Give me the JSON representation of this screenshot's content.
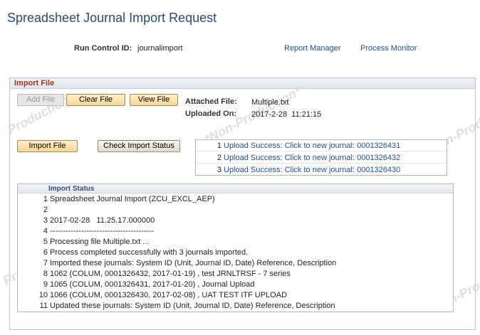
{
  "page": {
    "title": "Spreadsheet Journal Import Request"
  },
  "run_control": {
    "label": "Run Control ID:",
    "value": "journalimport"
  },
  "header_links": {
    "report_manager": "Report Manager",
    "process_monitor": "Process Monitor"
  },
  "watermark": {
    "text_a": "*Non-Production*",
    "text_b": "Production*",
    "text_c": "*Non-Production*"
  },
  "import_file": {
    "title": "Import File",
    "buttons": {
      "add_file": "Add File",
      "clear_file": "Clear File",
      "view_file": "View File",
      "import_file": "Import File",
      "check_status": "Check Import Status"
    },
    "attached_label": "Attached File:",
    "attached_value": "Multiple.txt",
    "uploaded_label": "Uploaded On:",
    "uploaded_value": "2017-2-28  11:21:15"
  },
  "upload_results": [
    {
      "num": "1",
      "text": "Upload Success: Click to new journal: 0001326431"
    },
    {
      "num": "2",
      "text": "Upload Success: Click to new journal: 0001326432"
    },
    {
      "num": "3",
      "text": "Upload Success: Click to new journal: 0001326430"
    }
  ],
  "import_status": {
    "title": "Import Status",
    "lines": [
      {
        "num": "1",
        "text": "Spreadsheet Journal Import (ZCU_EXCL_AEP)"
      },
      {
        "num": "2",
        "text": ""
      },
      {
        "num": "3",
        "text": "2017-02-28   11.25.17.000000"
      },
      {
        "num": "4",
        "text": "----------------------------------------"
      },
      {
        "num": "5",
        "text": "Processing file Multiple.txt ..."
      },
      {
        "num": "6",
        "text": "Process completed successfully with 3 journals imported."
      },
      {
        "num": "7",
        "text": "Imported these journals: System ID (Unit, Journal ID, Date) Reference, Description"
      },
      {
        "num": "8",
        "text": "1062 (COLUM, 0001326432, 2017-01-19) , test JRNLTRSF - 7 series"
      },
      {
        "num": "9",
        "text": "1065 (COLUM, 0001326431, 2017-01-20) , Journal Upload"
      },
      {
        "num": "10",
        "text": "1066 (COLUM, 0001326430, 2017-02-08) , UAT TEST ITF UPLOAD"
      },
      {
        "num": "11",
        "text": "Updated these journals: System ID (Unit, Journal ID, Date) Reference, Description"
      }
    ]
  }
}
